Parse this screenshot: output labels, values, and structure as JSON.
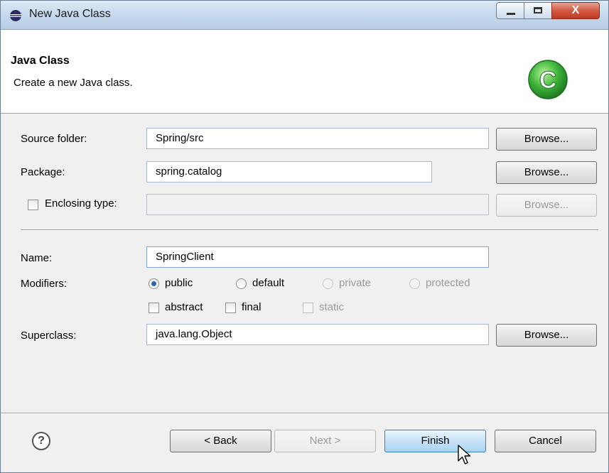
{
  "window": {
    "title": "New Java Class",
    "close_glyph": "X",
    "icons": {
      "app": "eclipse-icon",
      "minimize": "minimize-icon",
      "maximize": "maximize-icon",
      "close": "close-icon"
    }
  },
  "banner": {
    "title": "Java Class",
    "description": "Create a new Java class.",
    "logo_letter": "C",
    "logo_color": "#2fa52f"
  },
  "form": {
    "source_folder": {
      "label": "Source folder:",
      "value": "Spring/src",
      "button": "Browse..."
    },
    "package": {
      "label": "Package:",
      "value": "spring.catalog",
      "button": "Browse..."
    },
    "enclosing_type": {
      "label": "Enclosing type:",
      "value": "",
      "checked": false,
      "button": "Browse..."
    },
    "name": {
      "label": "Name:",
      "value": "SpringClient"
    },
    "modifiers": {
      "label": "Modifiers:",
      "access": [
        {
          "label": "public",
          "selected": true,
          "enabled": true
        },
        {
          "label": "default",
          "selected": false,
          "enabled": true
        },
        {
          "label": "private",
          "selected": false,
          "enabled": false
        },
        {
          "label": "protected",
          "selected": false,
          "enabled": false
        }
      ],
      "flags": [
        {
          "label": "abstract",
          "checked": false,
          "enabled": true
        },
        {
          "label": "final",
          "checked": false,
          "enabled": true
        },
        {
          "label": "static",
          "checked": false,
          "enabled": false
        }
      ]
    },
    "superclass": {
      "label": "Superclass:",
      "value": "java.lang.Object",
      "button": "Browse..."
    }
  },
  "footer": {
    "help_glyph": "?",
    "back": "< Back",
    "next": "Next >",
    "finish": "Finish",
    "cancel": "Cancel"
  }
}
